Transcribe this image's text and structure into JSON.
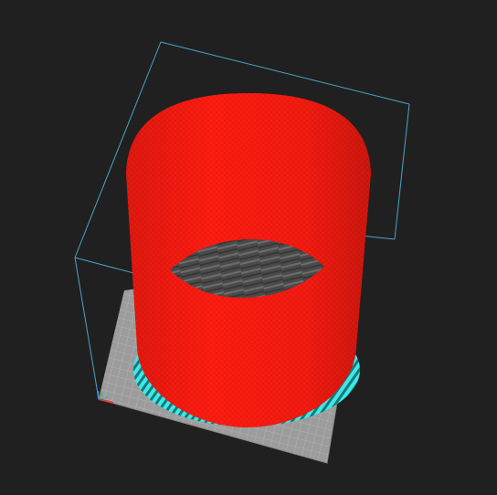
{
  "viewer": {
    "background_color": "#202020",
    "bed_color": "#9c9c9c",
    "bed_grid_color": "#b4b4b4",
    "bounding_box_color": "#4aa3c8",
    "model_color": "#ff1a10",
    "skirt_color": "#39e6e6",
    "interior_color": "#4a4a4a",
    "axis_x_color": "#d04040",
    "axis_y_color": "#40c040",
    "axis_z_color": "#4a7cff"
  }
}
